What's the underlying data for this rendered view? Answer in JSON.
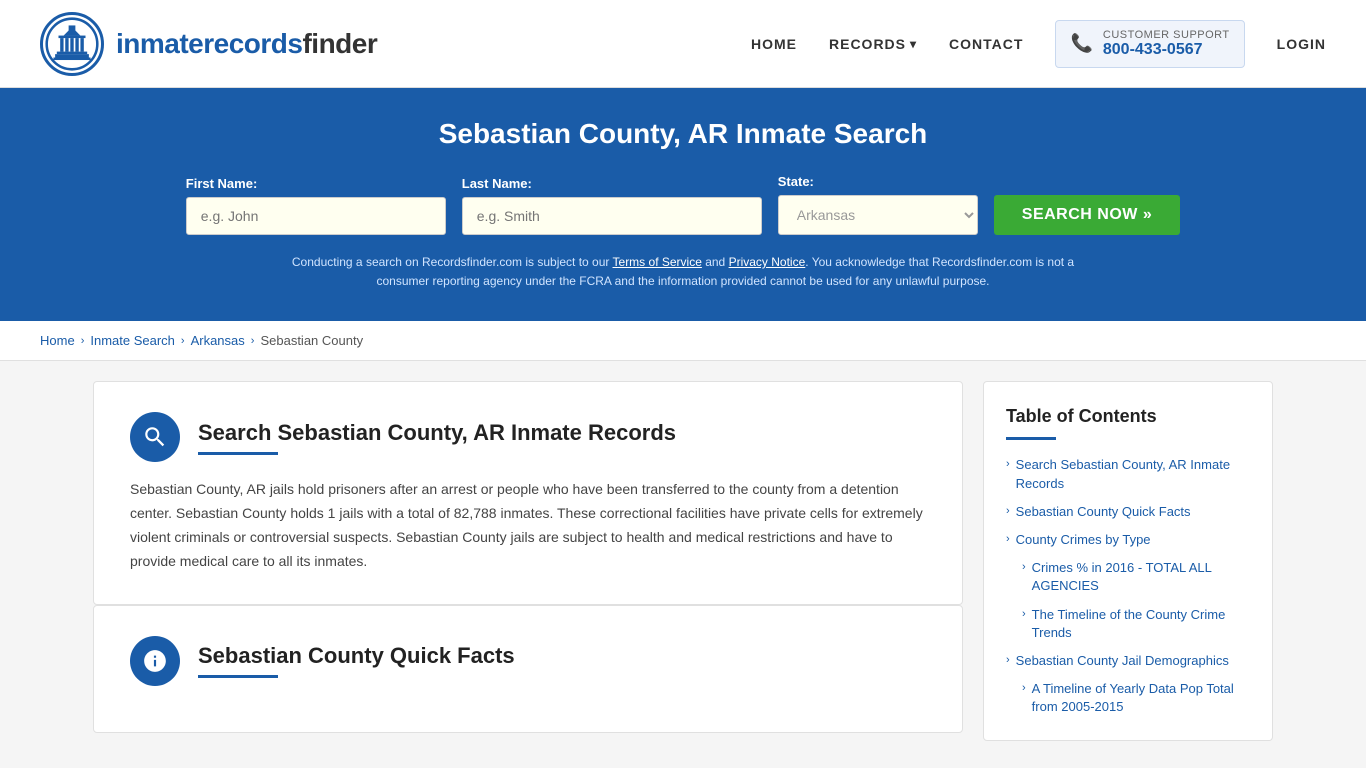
{
  "site": {
    "logo_text_plain": "inmaterecords",
    "logo_text_bold": "finder",
    "logo_icon": "🏛️"
  },
  "nav": {
    "home_label": "HOME",
    "records_label": "RECORDS",
    "contact_label": "CONTACT",
    "support_label": "CUSTOMER SUPPORT",
    "support_number": "800-433-0567",
    "login_label": "LOGIN"
  },
  "search_banner": {
    "title": "Sebastian County, AR Inmate Search",
    "first_name_label": "First Name:",
    "first_name_placeholder": "e.g. John",
    "last_name_label": "Last Name:",
    "last_name_placeholder": "e.g. Smith",
    "state_label": "State:",
    "state_value": "Arkansas",
    "search_button": "SEARCH NOW",
    "disclaimer": "Conducting a search on Recordsfinder.com is subject to our Terms of Service and Privacy Notice. You acknowledge that Recordsfinder.com is not a consumer reporting agency under the FCRA and the information provided cannot be used for any unlawful purpose.",
    "tos_link": "Terms of Service",
    "privacy_link": "Privacy Notice"
  },
  "breadcrumb": {
    "home": "Home",
    "inmate_search": "Inmate Search",
    "state": "Arkansas",
    "county": "Sebastian County"
  },
  "main_section": {
    "card1": {
      "title": "Search Sebastian County, AR Inmate Records",
      "body": "Sebastian County, AR jails hold prisoners after an arrest or people who have been transferred to the county from a detention center. Sebastian County holds 1 jails with a total of 82,788 inmates. These correctional facilities have private cells for extremely violent criminals or controversial suspects. Sebastian County jails are subject to health and medical restrictions and have to provide medical care to all its inmates."
    },
    "card2": {
      "title": "Sebastian County Quick Facts"
    }
  },
  "toc": {
    "title": "Table of Contents",
    "items": [
      {
        "label": "Search Sebastian County, AR Inmate Records",
        "sub": false
      },
      {
        "label": "Sebastian County Quick Facts",
        "sub": false
      },
      {
        "label": "County Crimes by Type",
        "sub": false
      },
      {
        "label": "Crimes % in 2016 - TOTAL ALL AGENCIES",
        "sub": true
      },
      {
        "label": "The Timeline of the County Crime Trends",
        "sub": true
      },
      {
        "label": "Sebastian County Jail Demographics",
        "sub": false
      },
      {
        "label": "A Timeline of Yearly Data Pop Total from 2005-2015",
        "sub": true
      }
    ]
  }
}
